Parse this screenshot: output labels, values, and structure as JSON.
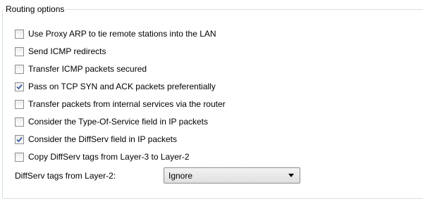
{
  "group": {
    "title": "Routing options"
  },
  "options": [
    {
      "label": "Use Proxy ARP to tie remote stations into the LAN",
      "checked": false
    },
    {
      "label": "Send ICMP redirects",
      "checked": false
    },
    {
      "label": "Transfer ICMP packets secured",
      "checked": false
    },
    {
      "label": "Pass on TCP SYN and ACK packets preferentially",
      "checked": true
    },
    {
      "label": "Transfer packets from internal services via the router",
      "checked": false
    },
    {
      "label": "Consider the Type-Of-Service field in IP packets",
      "checked": false
    },
    {
      "label": "Consider the DiffServ field in IP packets",
      "checked": true
    },
    {
      "label": "Copy DiffServ tags from Layer-3 to Layer-2",
      "checked": false
    }
  ],
  "diffserv_layer2": {
    "label": "DiffServ tags from Layer-2:",
    "value": "Ignore",
    "icon": "chevron-down-icon"
  },
  "colors": {
    "border": "#d5dfe5",
    "checkmark": "#3a5d9c"
  }
}
